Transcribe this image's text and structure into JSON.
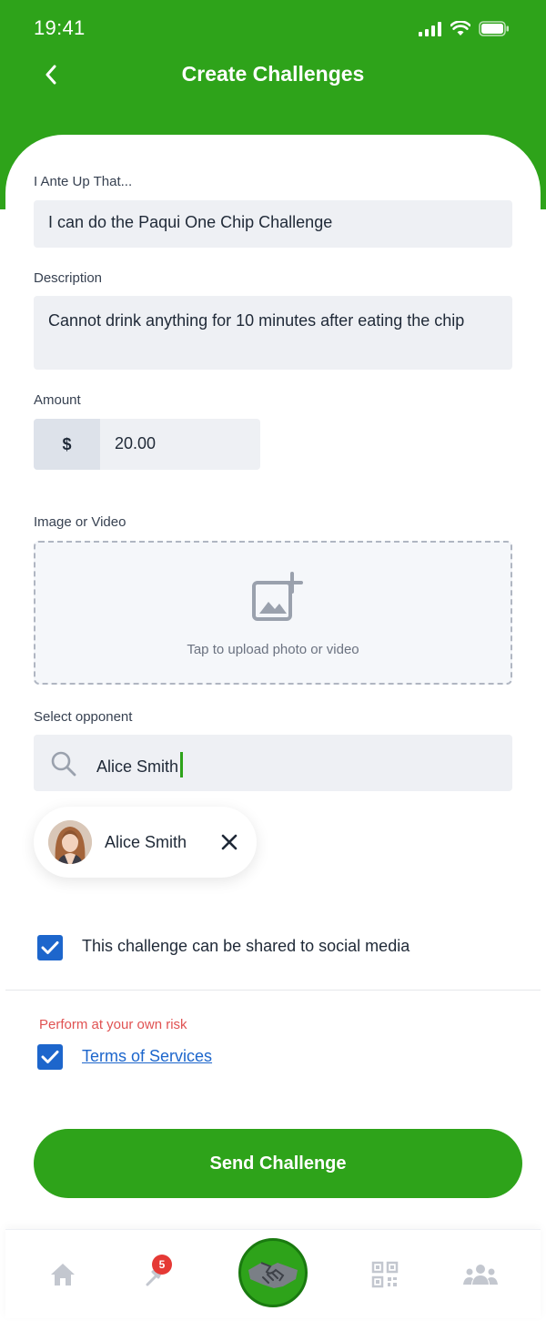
{
  "status_bar": {
    "time": "19:41"
  },
  "header": {
    "title": "Create Challenges"
  },
  "form": {
    "ante": {
      "label": "I Ante Up That...",
      "value": "I can do the Paqui One Chip Challenge"
    },
    "description": {
      "label": "Description",
      "value": "Cannot drink anything for 10 minutes after eating the chip"
    },
    "amount": {
      "label": "Amount",
      "currency": "$",
      "value": "20.00"
    },
    "media": {
      "label": "Image or Video",
      "hint": "Tap to upload photo or video"
    },
    "opponent": {
      "label": "Select opponent",
      "search_value": "Alice Smith",
      "selected": [
        {
          "name": "Alice Smith"
        }
      ]
    },
    "share_checkbox": {
      "checked": true,
      "label": "This challenge can be shared to social media"
    },
    "risk_notice": "Perform at your own risk",
    "terms_checkbox": {
      "checked": true,
      "label": "Terms of Services"
    },
    "submit_label": "Send Challenge"
  },
  "tabbar": {
    "items": [
      {
        "icon": "home-icon"
      },
      {
        "icon": "challenges-icon",
        "badge": "5"
      },
      {
        "icon": "handshake-icon"
      },
      {
        "icon": "qr-code-icon"
      },
      {
        "icon": "group-icon"
      }
    ]
  },
  "colors": {
    "brand_green": "#2ea31a",
    "checkbox_blue": "#1d66cc",
    "risk_red": "#e05252",
    "badge_red": "#e53935"
  }
}
